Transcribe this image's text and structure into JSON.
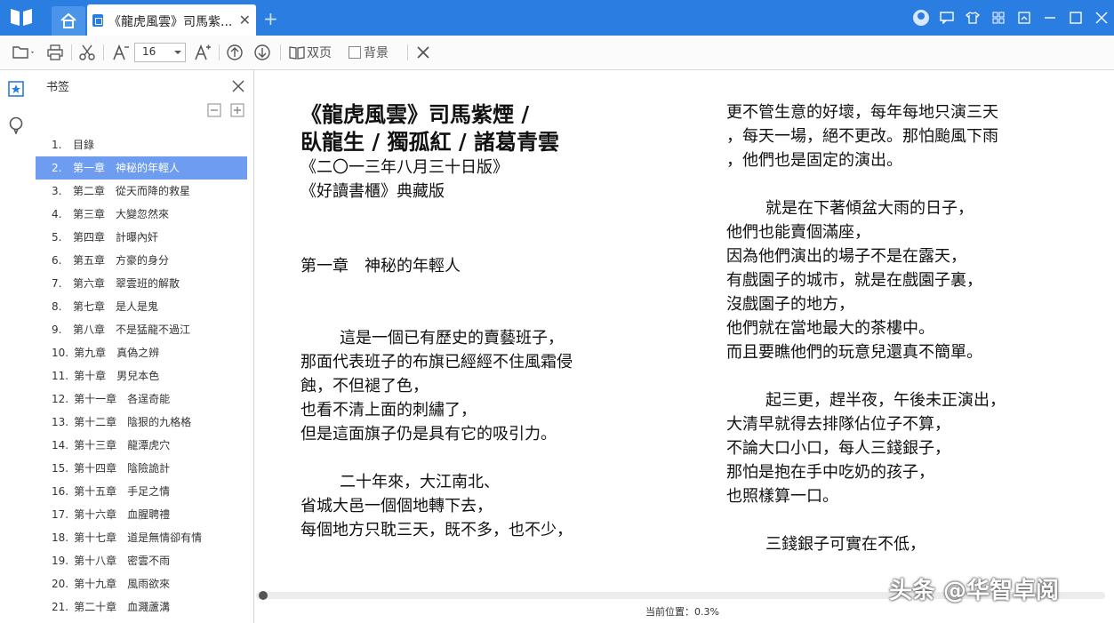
{
  "titlebar": {
    "tab_title": "《龍虎風雲》司馬紫...",
    "tab_close": "✕",
    "new_tab": "+"
  },
  "toolbar": {
    "font_size": "16",
    "double_page": "双页",
    "background": "背景"
  },
  "sidebar": {
    "title": "书签",
    "items": [
      {
        "num": "1.",
        "label": "目錄"
      },
      {
        "num": "2.",
        "label": "第一章　神秘的年輕人"
      },
      {
        "num": "3.",
        "label": "第二章　從天而降的救星"
      },
      {
        "num": "4.",
        "label": "第三章　大變忽然來"
      },
      {
        "num": "5.",
        "label": "第四章　計曝內奸"
      },
      {
        "num": "6.",
        "label": "第五章　方豪的身分"
      },
      {
        "num": "7.",
        "label": "第六章　翠雲班的解散"
      },
      {
        "num": "8.",
        "label": "第七章　是人是鬼"
      },
      {
        "num": "9.",
        "label": "第八章　不是猛龍不過江"
      },
      {
        "num": "10.",
        "label": "第九章　真偽之辨"
      },
      {
        "num": "11.",
        "label": "第十章　男兒本色"
      },
      {
        "num": "12.",
        "label": "第十一章　各逞奇能"
      },
      {
        "num": "13.",
        "label": "第十二章　陰狠的九格格"
      },
      {
        "num": "14.",
        "label": "第十三章　龍潭虎穴"
      },
      {
        "num": "15.",
        "label": "第十四章　陰險詭計"
      },
      {
        "num": "16.",
        "label": "第十五章　手足之情"
      },
      {
        "num": "17.",
        "label": "第十六章　血腥聘禮"
      },
      {
        "num": "18.",
        "label": "第十七章　道是無情卻有情"
      },
      {
        "num": "19.",
        "label": "第十八章　密雲不雨"
      },
      {
        "num": "20.",
        "label": "第十九章　風雨欲來"
      },
      {
        "num": "21.",
        "label": "第二十章　血濺蘆溝"
      }
    ],
    "active_index": 1
  },
  "page": {
    "title_line1": "《龍虎風雲》司馬紫煙 /",
    "title_line2": "臥龍生 / 獨孤紅 / 諸葛青雲",
    "edition1": "《二〇一三年八月三十日版》",
    "edition2": "《好讀書櫃》典藏版",
    "chapter": "第一章　神秘的年輕人",
    "col1_p1": [
      "這是一個已有歷史的賣藝班子，",
      "那面代表班子的布旗已經經不住風霜侵",
      "蝕，不但褪了色，",
      "也看不清上面的刺繡了，",
      "但是這面旗子仍是具有它的吸引力。"
    ],
    "col1_p2": [
      "二十年來，大江南北、",
      "省城大邑一個個地轉下去，",
      "每個地方只耽三天，既不多，也不少，"
    ],
    "col2_p1": [
      "更不管生意的好壞，每年每地只演三天",
      "，每天一場，絕不更改。那怕颱風下雨",
      "，他們也是固定的演出。"
    ],
    "col2_p2": [
      "就是在下著傾盆大雨的日子，",
      "他們也能賣個滿座，",
      "因為他們演出的場子不是在露天，",
      "有戲園子的城市，就是在戲園子裏，",
      "沒戲園子的地方，",
      "他們就在當地最大的茶樓中。",
      "而且要瞧他們的玩意兒還真不簡單。"
    ],
    "col2_p3": [
      "起三更，趕半夜，午後未正演出，",
      "大清早就得去排隊佔位子不算，",
      "不論大口小口，每人三錢銀子，",
      "那怕是抱在手中吃奶的孩子，",
      "也照樣算一口。"
    ],
    "col2_p4": [
      "三錢銀子可實在不低，"
    ]
  },
  "status": {
    "position_text": "当前位置：0.3%",
    "progress": 0.003
  },
  "watermark": "头条 @华智卓阅",
  "colors": {
    "titlebar": "#2a7de1",
    "active_bookmark": "#6d9cf0"
  }
}
